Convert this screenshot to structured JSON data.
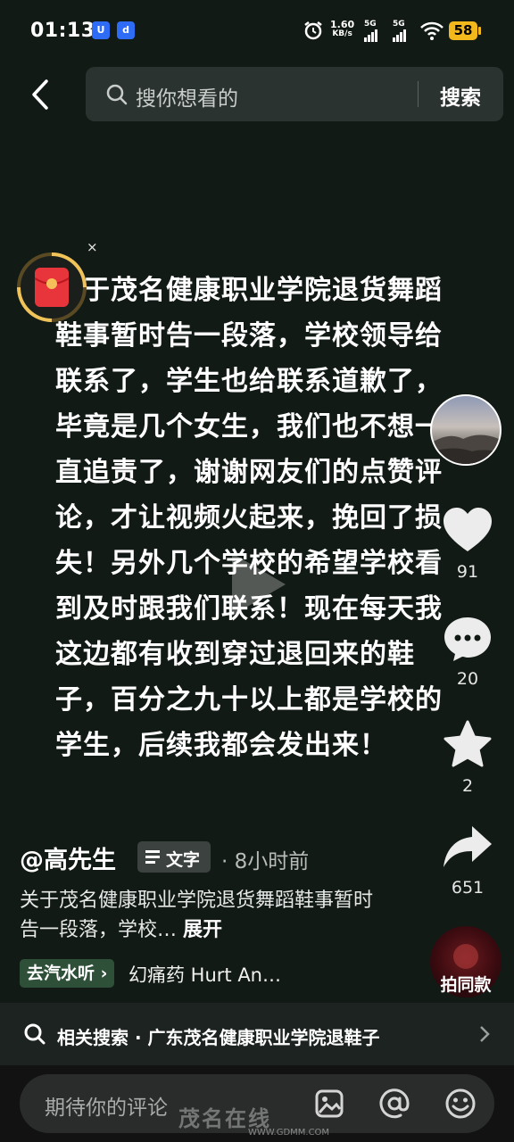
{
  "status_bar": {
    "time": "01:13",
    "net_speed_value": "1.60",
    "net_speed_unit": "KB/s",
    "sim1": "5G",
    "sim2": "5G",
    "battery": "58"
  },
  "search": {
    "placeholder": "搜你想看的",
    "button": "搜索"
  },
  "video_text": "关于茂名健康职业学院退货舞蹈鞋事暂时告一段落，学校领导给联系了，学生也给联系道歉了，毕竟是几个女生，我们也不想一直追责了，谢谢网友们的点赞评论，才让视频火起来，挽回了损失！另外几个学校的希望学校看到及时跟我们联系！现在每天我这边都有收到穿过退回来的鞋子，百分之九十以上都是学校的学生，后续我都会发出来！",
  "close_mark": "×",
  "side": {
    "likes": "91",
    "comments": "20",
    "favorites": "2",
    "shares": "651",
    "same_style": "拍同款"
  },
  "post": {
    "author": "@高先生",
    "tag": "文字",
    "time_ago": "· 8小时前",
    "description": "关于茂名健康职业学院退货舞蹈鞋事暂时告一段落，学校…",
    "expand": "展开",
    "music_tag": "去汽水听",
    "music_name": "幻痛药 Hurt An…"
  },
  "related": {
    "text": "相关搜索 · 广东茂名健康职业学院退鞋子"
  },
  "comment": {
    "placeholder": "期待你的评论"
  },
  "watermark": {
    "text": "茂名在线",
    "url": "WWW.GDMM.COM"
  }
}
